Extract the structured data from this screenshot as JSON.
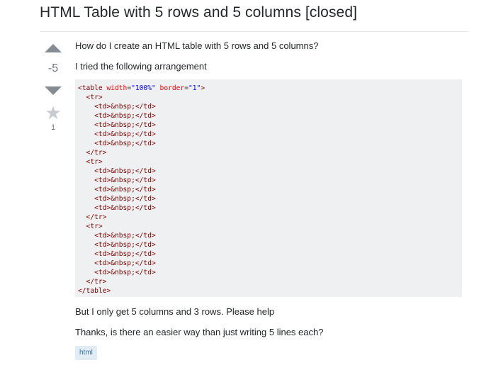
{
  "question": {
    "title": "HTML Table with 5 rows and 5 columns [closed]",
    "votes": "-5",
    "favorites": "1",
    "paragraphs": [
      "How do I create an HTML table with 5 rows and 5 columns?",
      "I tried the following arrangement",
      "But I only get 5 columns and 3 rows. Please help",
      "Thanks, is there an easier way than just writing 5 lines each?"
    ],
    "code": {
      "open_tag_start": "<table ",
      "attr_width": "width",
      "eq1": "=",
      "val_width": "\"100%\"",
      "attr_border": "border",
      "eq2": "=",
      "val_border": "\"1\"",
      "open_tag_end": ">",
      "lines": [
        "  <tr>",
        "    <td>&nbsp;</td>",
        "    <td>&nbsp;</td>",
        "    <td>&nbsp;</td>",
        "    <td>&nbsp;</td>",
        "    <td>&nbsp;</td>",
        "  </tr>",
        "  <tr>",
        "    <td>&nbsp;</td>",
        "    <td>&nbsp;</td>",
        "    <td>&nbsp;</td>",
        "    <td>&nbsp;</td>",
        "    <td>&nbsp;</td>",
        "  </tr>",
        "  <tr>",
        "    <td>&nbsp;</td>",
        "    <td>&nbsp;</td>",
        "    <td>&nbsp;</td>",
        "    <td>&nbsp;</td>",
        "    <td>&nbsp;</td>",
        "  </tr>",
        "</table>"
      ]
    },
    "tags": [
      "html"
    ]
  },
  "icons": {
    "upvote": "upvote-arrow-icon",
    "downvote": "downvote-arrow-icon",
    "favorite": "star-icon"
  },
  "colors": {
    "tag_bg": "#e1ecf4",
    "tag_text": "#39739d",
    "code_bg": "#eff0f1",
    "code_tag": "#800000",
    "code_attr": "#ff0000",
    "code_string": "#0000ff"
  }
}
